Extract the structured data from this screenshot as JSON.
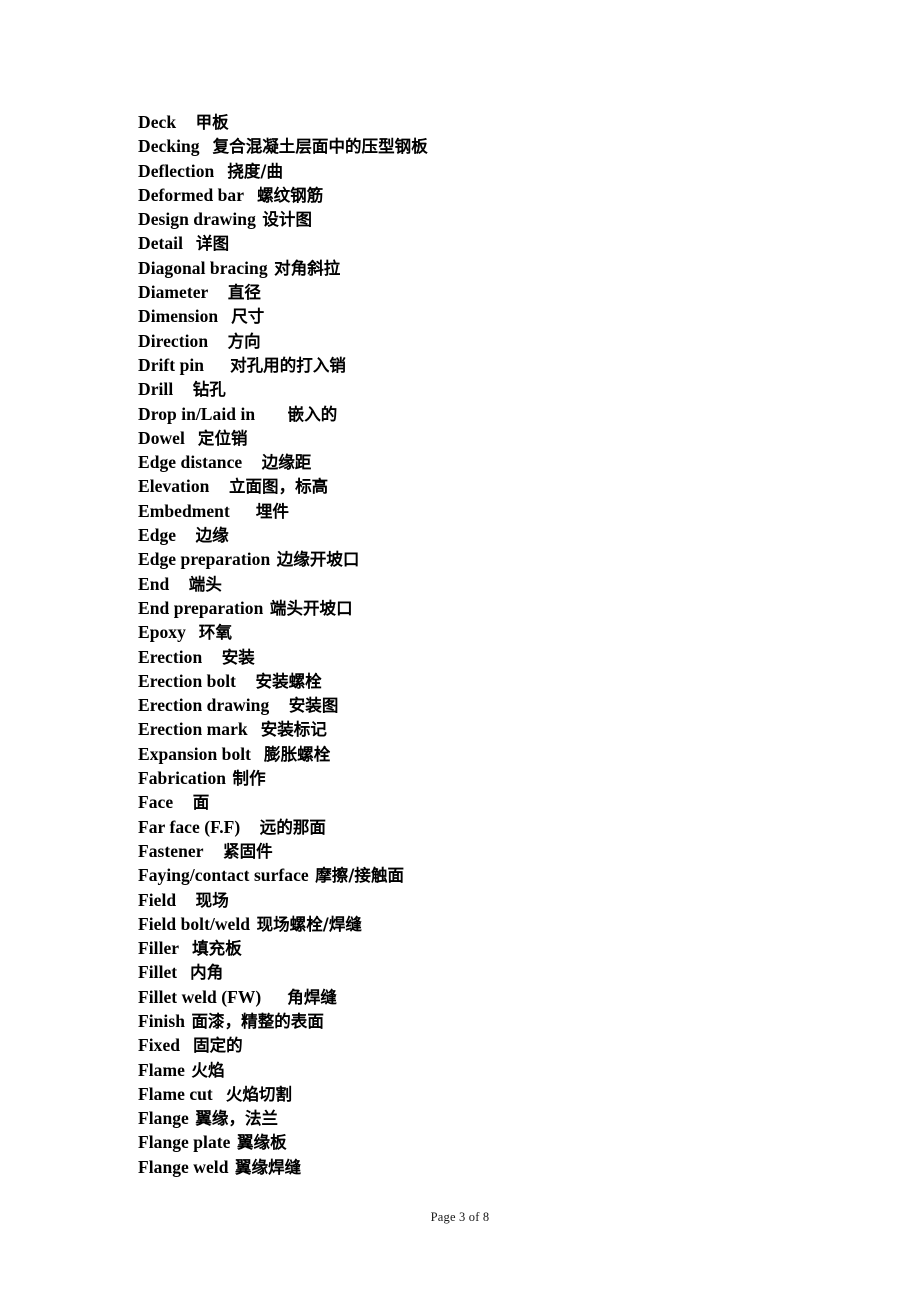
{
  "document": {
    "type": "glossary",
    "language_pair": "English-Chinese",
    "footer_text": "Page 3 of 8",
    "page_number": 3,
    "page_total": 8
  },
  "entries": [
    {
      "term": "Deck",
      "gap": 3,
      "translation": "甲板"
    },
    {
      "term": "Decking",
      "gap": 2,
      "translation": "复合混凝土层面中的压型钢板"
    },
    {
      "term": "Deflection",
      "gap": 2,
      "translation": "挠度/曲"
    },
    {
      "term": "Deformed bar",
      "gap": 2,
      "translation": "螺纹钢筋"
    },
    {
      "term": "Design drawing",
      "gap": 1,
      "translation": "设计图"
    },
    {
      "term": "Detail",
      "gap": 2,
      "translation": "详图"
    },
    {
      "term": "Diagonal bracing",
      "gap": 1,
      "translation": "对角斜拉"
    },
    {
      "term": "Diameter",
      "gap": 3,
      "translation": "直径"
    },
    {
      "term": "Dimension",
      "gap": 2,
      "translation": "尺寸"
    },
    {
      "term": "Direction",
      "gap": 3,
      "translation": "方向"
    },
    {
      "term": "Drift pin",
      "gap": 4,
      "translation": "对孔用的打入销"
    },
    {
      "term": "Drill",
      "gap": 3,
      "translation": "钻孔"
    },
    {
      "term": "Drop in/Laid in",
      "gap": 5,
      "translation": "嵌入的"
    },
    {
      "term": "Dowel",
      "gap": 2,
      "translation": "定位销"
    },
    {
      "term": "Edge distance",
      "gap": 3,
      "translation": "边缘距"
    },
    {
      "term": "Elevation",
      "gap": 3,
      "translation": "立面图，标高"
    },
    {
      "term": "Embedment",
      "gap": 4,
      "translation": "埋件"
    },
    {
      "term": "Edge",
      "gap": 3,
      "translation": "边缘"
    },
    {
      "term": "Edge preparation",
      "gap": 1,
      "translation": "边缘开坡口"
    },
    {
      "term": "End",
      "gap": 3,
      "translation": "端头"
    },
    {
      "term": "End preparation",
      "gap": 1,
      "translation": "端头开坡口"
    },
    {
      "term": "Epoxy",
      "gap": 2,
      "translation": "环氧"
    },
    {
      "term": "Erection",
      "gap": 3,
      "translation": "安装"
    },
    {
      "term": "Erection bolt",
      "gap": 3,
      "translation": "安装螺栓"
    },
    {
      "term": "Erection drawing",
      "gap": 3,
      "translation": "安装图"
    },
    {
      "term": "Erection mark",
      "gap": 2,
      "translation": "安装标记"
    },
    {
      "term": "Expansion bolt",
      "gap": 2,
      "translation": "膨胀螺栓"
    },
    {
      "term": "Fabrication",
      "gap": 1,
      "translation": "制作"
    },
    {
      "term": "Face",
      "gap": 3,
      "translation": "面"
    },
    {
      "term": "Far face (F.F)",
      "gap": 3,
      "translation": "远的那面"
    },
    {
      "term": "Fastener",
      "gap": 3,
      "translation": "紧固件"
    },
    {
      "term": "Faying/contact surface",
      "gap": 1,
      "translation": "摩擦/接触面"
    },
    {
      "term": "Field",
      "gap": 3,
      "translation": "现场"
    },
    {
      "term": "Field bolt/weld",
      "gap": 1,
      "translation": "现场螺栓/焊缝"
    },
    {
      "term": "Filler",
      "gap": 2,
      "translation": "填充板"
    },
    {
      "term": "Fillet",
      "gap": 2,
      "translation": "内角"
    },
    {
      "term": "Fillet weld (FW)",
      "gap": 4,
      "translation": "角焊缝"
    },
    {
      "term": "Finish",
      "gap": 1,
      "translation": "面漆，精整的表面"
    },
    {
      "term": "Fixed",
      "gap": 2,
      "translation": "固定的"
    },
    {
      "term": "Flame",
      "gap": 1,
      "translation": "火焰"
    },
    {
      "term": "Flame cut",
      "gap": 2,
      "translation": "火焰切割"
    },
    {
      "term": "Flange",
      "gap": 1,
      "translation": "翼缘，法兰"
    },
    {
      "term": "Flange plate",
      "gap": 1,
      "translation": "翼缘板"
    },
    {
      "term": "Flange weld",
      "gap": 1,
      "translation": "翼缘焊缝"
    }
  ]
}
